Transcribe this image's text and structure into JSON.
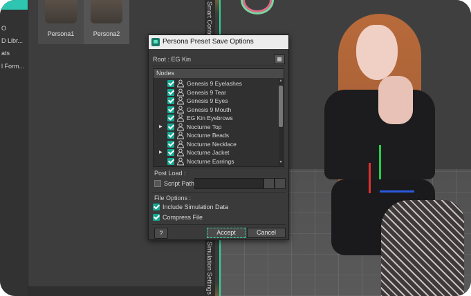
{
  "library": {
    "items": [
      "O",
      "D Libr...",
      "ats",
      "l Form..."
    ]
  },
  "content": {
    "personas": [
      {
        "label": "Persona1"
      },
      {
        "label": "Persona2"
      }
    ]
  },
  "side_tabs": {
    "top": "Smart Conte...",
    "bottom": "Simulation Settings"
  },
  "dialog": {
    "title": "Persona Preset Save Options",
    "root_label": "Root : EG Kin",
    "nodes_header": "Nodes",
    "nodes": [
      {
        "label": "Genesis 9 Eyelashes",
        "checked": true,
        "expandable": false
      },
      {
        "label": "Genesis 9 Tear",
        "checked": true,
        "expandable": false
      },
      {
        "label": "Genesis 9 Eyes",
        "checked": true,
        "expandable": false
      },
      {
        "label": "Genesis 9 Mouth",
        "checked": true,
        "expandable": false
      },
      {
        "label": "EG Kin Eyebrows",
        "checked": true,
        "expandable": false
      },
      {
        "label": "Nocturne Top",
        "checked": true,
        "expandable": true
      },
      {
        "label": "Nocturne Beads",
        "checked": true,
        "expandable": false
      },
      {
        "label": "Nocturne Necklace",
        "checked": true,
        "expandable": false
      },
      {
        "label": "Nocturne Jacket",
        "checked": true,
        "expandable": true
      },
      {
        "label": "Nocturne Earrings",
        "checked": true,
        "expandable": false
      }
    ],
    "post_load_label": "Post Load :",
    "script_path_label": "Script Path:",
    "script_path_value": "",
    "file_options_label": "File Options :",
    "include_sim_label": "Include Simulation Data",
    "compress_label": "Compress File",
    "help_label": "?",
    "accept_label": "Accept",
    "cancel_label": "Cancel"
  },
  "colors": {
    "accent": "#16a893",
    "focus": "#35d6a0",
    "viewport_divider": "#2fd39a"
  }
}
